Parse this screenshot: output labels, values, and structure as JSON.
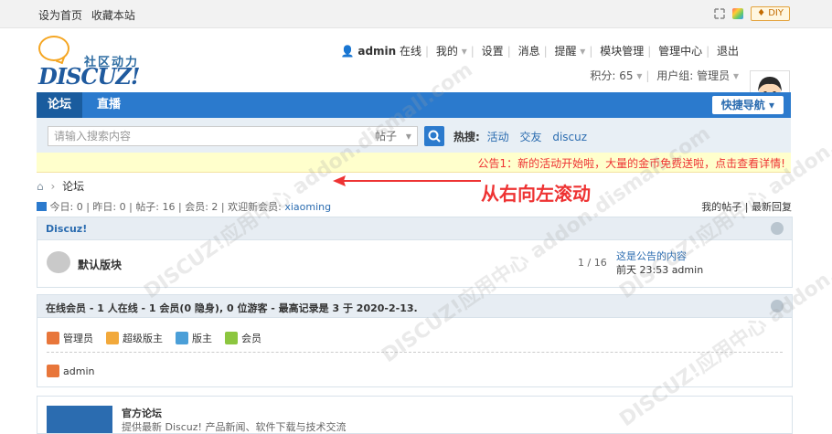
{
  "topbar": {
    "set_home": "设为首页",
    "bookmark": "收藏本站",
    "diy": "DIY"
  },
  "logo": {
    "cn": "社区动力",
    "en": "DISCUZ!"
  },
  "user": {
    "name": "admin",
    "status": "在线",
    "links": [
      "我的",
      "设置",
      "消息",
      "提醒",
      "模块管理",
      "管理中心",
      "退出"
    ],
    "points": "积分: 65",
    "group": "用户组: 管理员"
  },
  "nav": {
    "tabs": [
      "论坛",
      "直播"
    ],
    "quick": "快捷导航"
  },
  "search": {
    "placeholder": "请输入搜索内容",
    "type": "帖子",
    "hot_label": "热搜:",
    "hot_items": [
      "活动",
      "交友",
      "discuz"
    ]
  },
  "notice": {
    "text": "公告1：新的活动开始啦，大量的金币免费送啦，点击查看详情!"
  },
  "annotation": "从右向左滚动",
  "breadcrumb": "论坛",
  "stats": {
    "today": "今日: 0",
    "yesterday": "昨日: 0",
    "posts": "帖子: 16",
    "members": "会员: 2",
    "welcome": "欢迎新会员: ",
    "newest": "xiaoming",
    "my_posts": "我的帖子",
    "latest": "最新回复"
  },
  "forum_group": {
    "title": "Discuz!",
    "forum": {
      "name": "默认版块",
      "count": "1 / 16",
      "last_title": "这是公告的内容",
      "last_meta": "前天 23:53 admin"
    }
  },
  "online": {
    "title": "在线会员 - 1 人在线 - 1 会员(0 隐身), 0 位游客 - 最高记录是 3 于 2020-2-13.",
    "roles": [
      {
        "label": "管理员",
        "color": "#e8763a"
      },
      {
        "label": "超级版主",
        "color": "#f2a93b"
      },
      {
        "label": "版主",
        "color": "#4b9fd8"
      },
      {
        "label": "会员",
        "color": "#8cc63f"
      }
    ],
    "member": "admin"
  },
  "friend": {
    "title": "官方论坛",
    "desc": "提供最新 Discuz! 产品新闻、软件下载与技术交流"
  },
  "watermark": "DISCUZ!应用中心 addon.dismall.com"
}
